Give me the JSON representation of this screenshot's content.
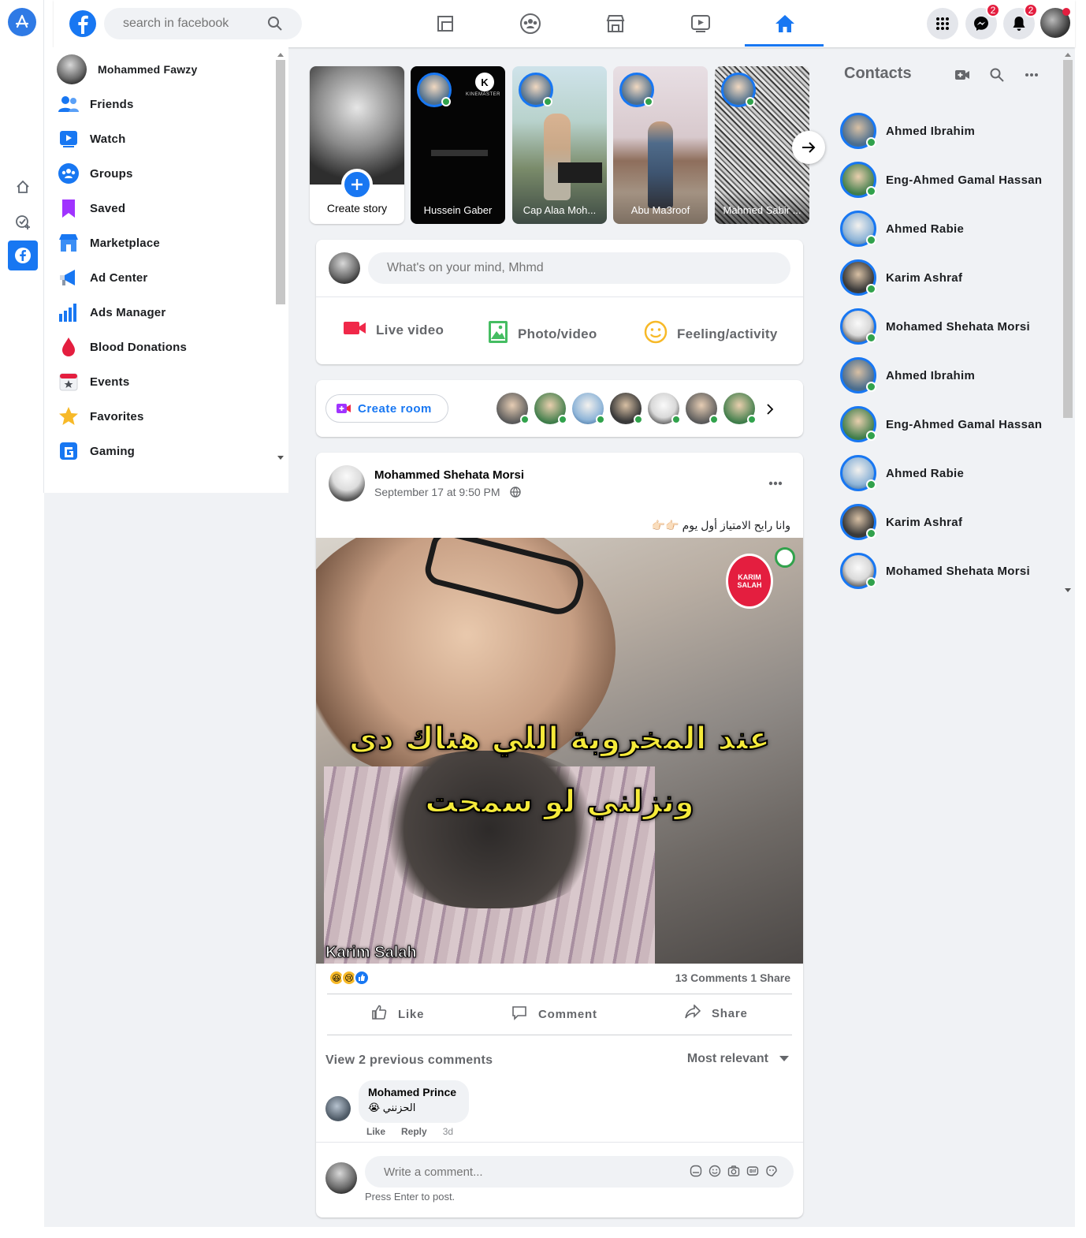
{
  "search": {
    "placeholder": "search in facebook"
  },
  "badges": {
    "messenger": "2",
    "notifications": "2"
  },
  "user": {
    "name": "Mohammed Fawzy"
  },
  "sidebar": {
    "items": [
      {
        "label": "Friends",
        "icon": "friends-icon"
      },
      {
        "label": "Watch",
        "icon": "watch-icon"
      },
      {
        "label": "Groups",
        "icon": "groups-icon"
      },
      {
        "label": "Saved",
        "icon": "saved-icon"
      },
      {
        "label": "Marketplace",
        "icon": "marketplace-icon"
      },
      {
        "label": "Ad Center",
        "icon": "ad-center-icon"
      },
      {
        "label": "Ads Manager",
        "icon": "ads-manager-icon"
      },
      {
        "label": "Blood Donations",
        "icon": "blood-donations-icon"
      },
      {
        "label": "Events",
        "icon": "events-icon"
      },
      {
        "label": "Favorites",
        "icon": "favorites-icon"
      },
      {
        "label": "Gaming",
        "icon": "gaming-icon"
      }
    ]
  },
  "stories": {
    "create_label": "Create story",
    "items": [
      {
        "name": "Hussein Gaber",
        "overlay": "KINEMASTER"
      },
      {
        "name": "Cap Alaa Moh..."
      },
      {
        "name": "Abu Ma3roof"
      },
      {
        "name": "Mahmed Sabir ..."
      }
    ]
  },
  "composer": {
    "placeholder": "What's on your mind, Mhmd",
    "live": "Live video",
    "photo": "Photo/video",
    "feeling": "Feeling/activity"
  },
  "rooms": {
    "create_label": "Create room"
  },
  "post": {
    "author": "Mohammed Shehata Morsi",
    "date": "September 17 at 9:50 PM",
    "text": "وانا رايح الامتياز أول يوم 👉🏻👉🏻",
    "image_caption_line1": "عند المخروبة اللي هناك دى",
    "image_caption_line2": "ونزلني لو سمحت",
    "image_watermark": "Karim Salah",
    "image_logo_text": "KARIM SALAH",
    "stats": "13 Comments 1 Share",
    "like": "Like",
    "comment": "Comment",
    "share": "Share",
    "view_previous": "View 2 previous comments",
    "sort": "Most relevant",
    "comment_author": "Mohamed Prince",
    "comment_text": "الحزنني 😭",
    "comment_like": "Like",
    "comment_reply": "Reply",
    "comment_time": "3d",
    "write_placeholder": "Write a comment...",
    "press_enter": "Press Enter to post."
  },
  "contacts": {
    "title": "Contacts",
    "items": [
      "Ahmed Ibrahim",
      "Eng-Ahmed Gamal Hassan",
      "Ahmed Rabie",
      "Karim Ashraf",
      "Mohamed Shehata Morsi",
      "Ahmed Ibrahim",
      "Eng-Ahmed Gamal Hassan",
      "Ahmed Rabie",
      "Karim Ashraf",
      "Mohamed Shehata Morsi"
    ]
  },
  "colors": {
    "brand": "#1877f2",
    "online": "#31a24c",
    "badge": "#e41e3f",
    "page_bg": "#f0f2f5"
  }
}
